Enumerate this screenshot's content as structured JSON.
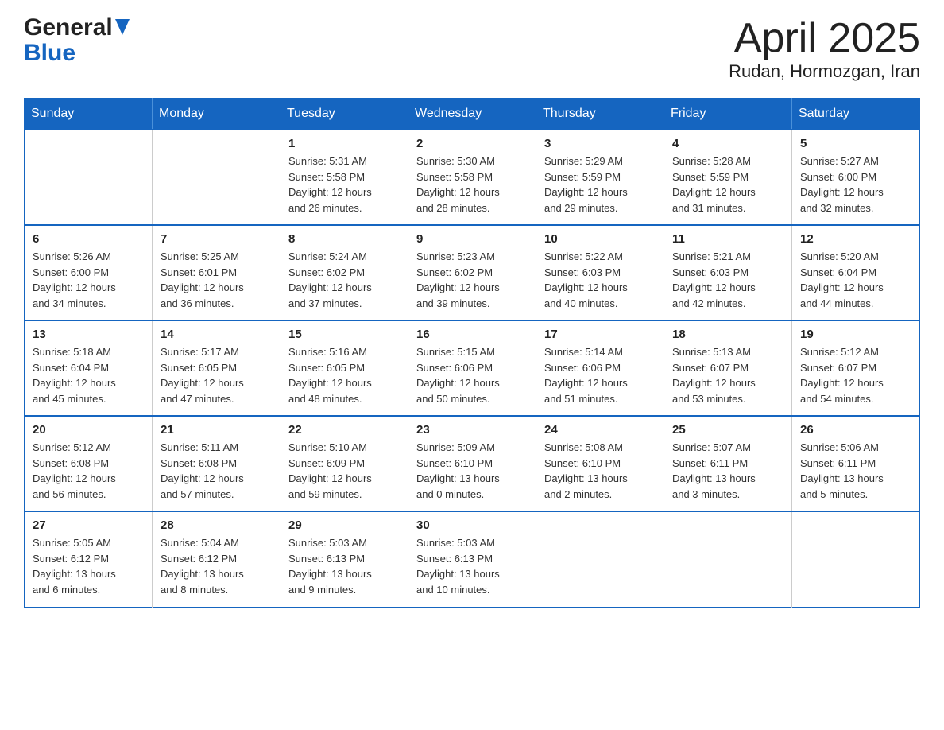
{
  "header": {
    "logo_line1": "General",
    "logo_line2": "Blue",
    "title": "April 2025",
    "subtitle": "Rudan, Hormozgan, Iran"
  },
  "calendar": {
    "days_of_week": [
      "Sunday",
      "Monday",
      "Tuesday",
      "Wednesday",
      "Thursday",
      "Friday",
      "Saturday"
    ],
    "weeks": [
      [
        {
          "day": "",
          "info": ""
        },
        {
          "day": "",
          "info": ""
        },
        {
          "day": "1",
          "info": "Sunrise: 5:31 AM\nSunset: 5:58 PM\nDaylight: 12 hours\nand 26 minutes."
        },
        {
          "day": "2",
          "info": "Sunrise: 5:30 AM\nSunset: 5:58 PM\nDaylight: 12 hours\nand 28 minutes."
        },
        {
          "day": "3",
          "info": "Sunrise: 5:29 AM\nSunset: 5:59 PM\nDaylight: 12 hours\nand 29 minutes."
        },
        {
          "day": "4",
          "info": "Sunrise: 5:28 AM\nSunset: 5:59 PM\nDaylight: 12 hours\nand 31 minutes."
        },
        {
          "day": "5",
          "info": "Sunrise: 5:27 AM\nSunset: 6:00 PM\nDaylight: 12 hours\nand 32 minutes."
        }
      ],
      [
        {
          "day": "6",
          "info": "Sunrise: 5:26 AM\nSunset: 6:00 PM\nDaylight: 12 hours\nand 34 minutes."
        },
        {
          "day": "7",
          "info": "Sunrise: 5:25 AM\nSunset: 6:01 PM\nDaylight: 12 hours\nand 36 minutes."
        },
        {
          "day": "8",
          "info": "Sunrise: 5:24 AM\nSunset: 6:02 PM\nDaylight: 12 hours\nand 37 minutes."
        },
        {
          "day": "9",
          "info": "Sunrise: 5:23 AM\nSunset: 6:02 PM\nDaylight: 12 hours\nand 39 minutes."
        },
        {
          "day": "10",
          "info": "Sunrise: 5:22 AM\nSunset: 6:03 PM\nDaylight: 12 hours\nand 40 minutes."
        },
        {
          "day": "11",
          "info": "Sunrise: 5:21 AM\nSunset: 6:03 PM\nDaylight: 12 hours\nand 42 minutes."
        },
        {
          "day": "12",
          "info": "Sunrise: 5:20 AM\nSunset: 6:04 PM\nDaylight: 12 hours\nand 44 minutes."
        }
      ],
      [
        {
          "day": "13",
          "info": "Sunrise: 5:18 AM\nSunset: 6:04 PM\nDaylight: 12 hours\nand 45 minutes."
        },
        {
          "day": "14",
          "info": "Sunrise: 5:17 AM\nSunset: 6:05 PM\nDaylight: 12 hours\nand 47 minutes."
        },
        {
          "day": "15",
          "info": "Sunrise: 5:16 AM\nSunset: 6:05 PM\nDaylight: 12 hours\nand 48 minutes."
        },
        {
          "day": "16",
          "info": "Sunrise: 5:15 AM\nSunset: 6:06 PM\nDaylight: 12 hours\nand 50 minutes."
        },
        {
          "day": "17",
          "info": "Sunrise: 5:14 AM\nSunset: 6:06 PM\nDaylight: 12 hours\nand 51 minutes."
        },
        {
          "day": "18",
          "info": "Sunrise: 5:13 AM\nSunset: 6:07 PM\nDaylight: 12 hours\nand 53 minutes."
        },
        {
          "day": "19",
          "info": "Sunrise: 5:12 AM\nSunset: 6:07 PM\nDaylight: 12 hours\nand 54 minutes."
        }
      ],
      [
        {
          "day": "20",
          "info": "Sunrise: 5:12 AM\nSunset: 6:08 PM\nDaylight: 12 hours\nand 56 minutes."
        },
        {
          "day": "21",
          "info": "Sunrise: 5:11 AM\nSunset: 6:08 PM\nDaylight: 12 hours\nand 57 minutes."
        },
        {
          "day": "22",
          "info": "Sunrise: 5:10 AM\nSunset: 6:09 PM\nDaylight: 12 hours\nand 59 minutes."
        },
        {
          "day": "23",
          "info": "Sunrise: 5:09 AM\nSunset: 6:10 PM\nDaylight: 13 hours\nand 0 minutes."
        },
        {
          "day": "24",
          "info": "Sunrise: 5:08 AM\nSunset: 6:10 PM\nDaylight: 13 hours\nand 2 minutes."
        },
        {
          "day": "25",
          "info": "Sunrise: 5:07 AM\nSunset: 6:11 PM\nDaylight: 13 hours\nand 3 minutes."
        },
        {
          "day": "26",
          "info": "Sunrise: 5:06 AM\nSunset: 6:11 PM\nDaylight: 13 hours\nand 5 minutes."
        }
      ],
      [
        {
          "day": "27",
          "info": "Sunrise: 5:05 AM\nSunset: 6:12 PM\nDaylight: 13 hours\nand 6 minutes."
        },
        {
          "day": "28",
          "info": "Sunrise: 5:04 AM\nSunset: 6:12 PM\nDaylight: 13 hours\nand 8 minutes."
        },
        {
          "day": "29",
          "info": "Sunrise: 5:03 AM\nSunset: 6:13 PM\nDaylight: 13 hours\nand 9 minutes."
        },
        {
          "day": "30",
          "info": "Sunrise: 5:03 AM\nSunset: 6:13 PM\nDaylight: 13 hours\nand 10 minutes."
        },
        {
          "day": "",
          "info": ""
        },
        {
          "day": "",
          "info": ""
        },
        {
          "day": "",
          "info": ""
        }
      ]
    ]
  }
}
